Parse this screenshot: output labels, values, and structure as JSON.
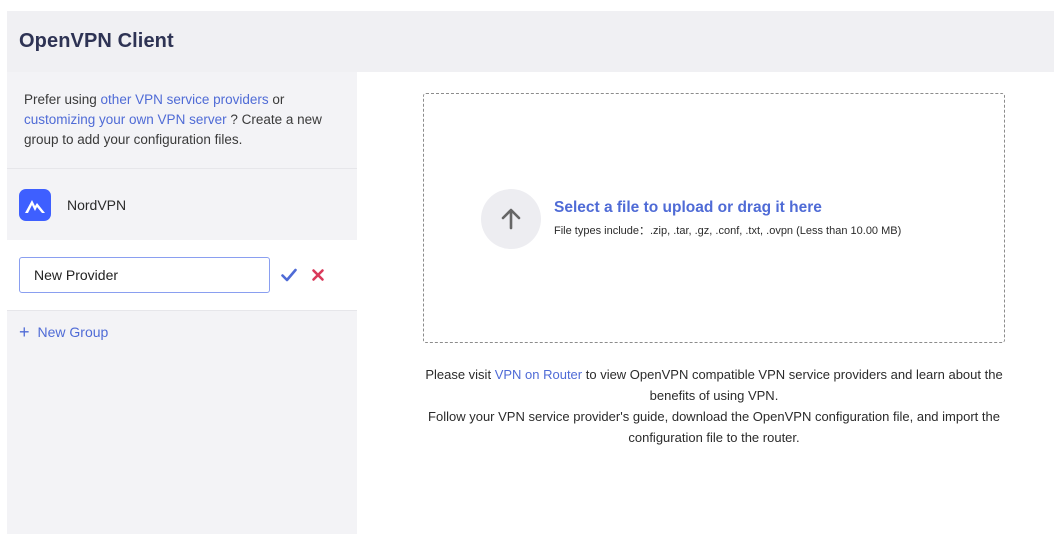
{
  "header": {
    "title": "OpenVPN Client"
  },
  "sidebar": {
    "intro": {
      "prefix": "Prefer using ",
      "link1": "other VPN service providers",
      "middle": " or ",
      "link2": "customizing your own VPN server",
      "suffix": " ? Create a new group to add your configuration files."
    },
    "providers": [
      {
        "name": "NordVPN",
        "icon": "nordvpn-logo-icon"
      }
    ],
    "editor": {
      "value": "New Provider",
      "confirm_icon": "checkmark-icon",
      "cancel_icon": "close-icon"
    },
    "new_group": {
      "icon": "plus-icon",
      "label": "New Group"
    }
  },
  "upload": {
    "icon": "arrow-up-icon",
    "title": "Select a file to upload or drag it here",
    "hint": "File types include：.zip, .tar, .gz, .conf, .txt, .ovpn (Less than 10.00 MB)"
  },
  "info": {
    "line1_prefix": "Please visit ",
    "line1_link": "VPN on Router",
    "line1_suffix": " to view OpenVPN compatible VPN service providers and learn about the benefits of using VPN.",
    "line2": "Follow your VPN service provider's guide, download the OpenVPN configuration file, and import the configuration file to the router."
  },
  "colors": {
    "accent": "#4f6bd6",
    "confirm": "#4f6bd6",
    "cancel": "#d9395a",
    "provider_logo": "#3e5fff"
  }
}
